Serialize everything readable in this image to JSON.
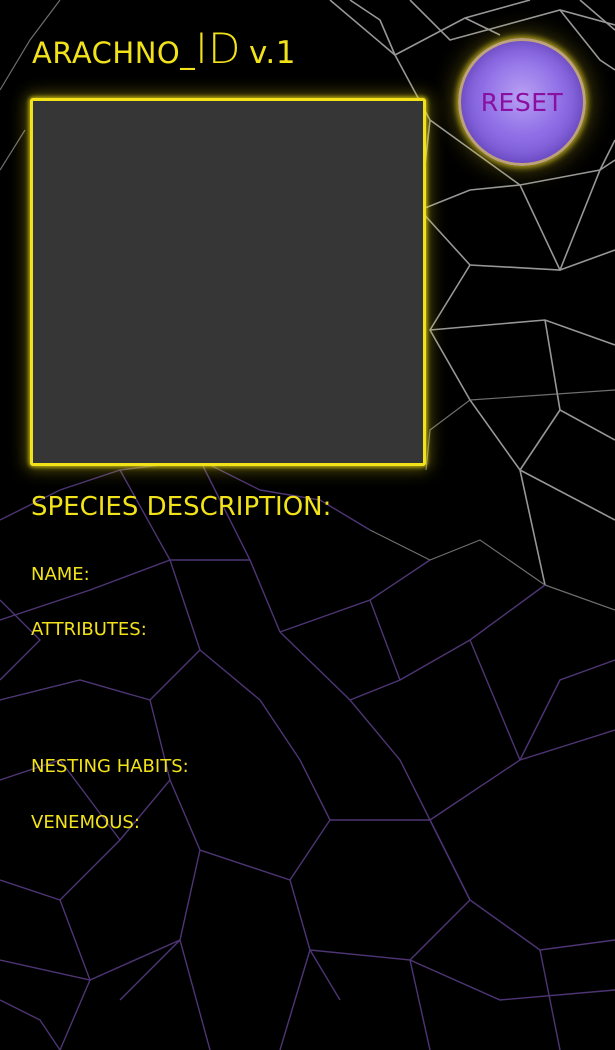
{
  "header": {
    "title_name": "ARACHNO_",
    "title_id": "ID",
    "title_version": "v.1"
  },
  "reset_button": {
    "label": "RESET"
  },
  "description": {
    "heading": "SPECIES DESCRIPTION:",
    "name_label": "NAME:",
    "attributes_label": "ATTRIBUTES:",
    "nesting_label": "NESTING HABITS:",
    "venemous_label": "VENEMOUS:"
  },
  "colors": {
    "background": "#000000",
    "accent_yellow": "#f2e21a",
    "reset_purple": "#8f6ee6",
    "reset_text": "#8a0fa0",
    "photo_frame_fill": "#363636",
    "web_lines_gray": "#9c9c9c",
    "web_lines_purple": "#5a3f86"
  }
}
